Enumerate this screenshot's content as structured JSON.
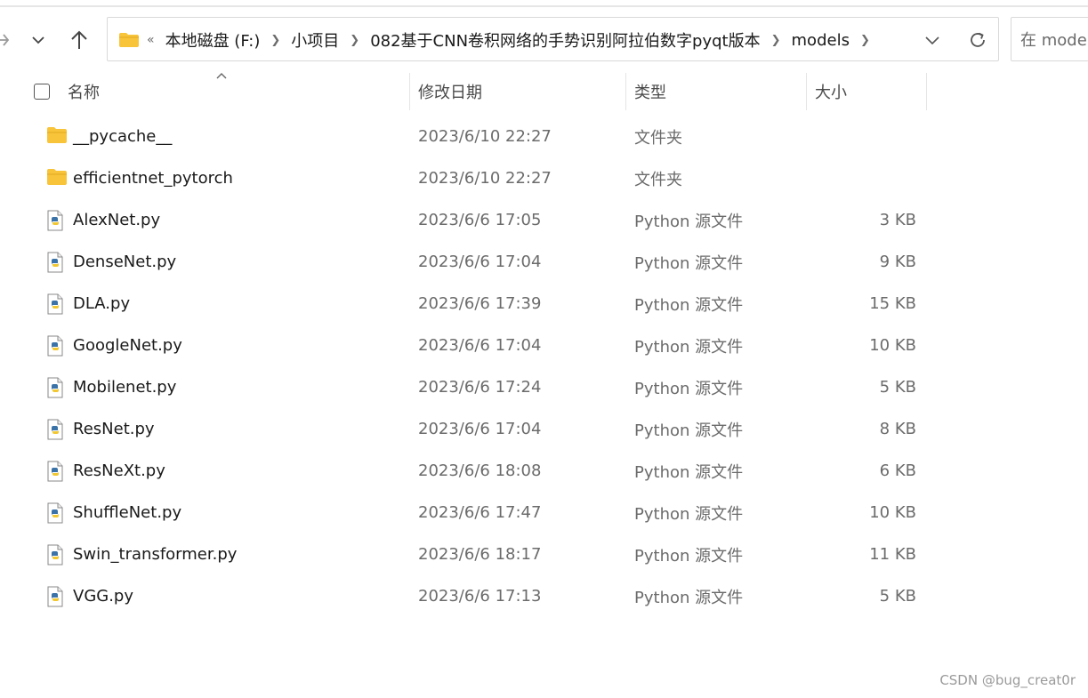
{
  "address": {
    "overflow": "«",
    "crumbs": [
      "本地磁盘 (F:)",
      "小项目",
      "082基于CNN卷积网络的手势识别阿拉伯数字pyqt版本",
      "models"
    ]
  },
  "search": {
    "placeholder": "在 models"
  },
  "columns": {
    "name": "名称",
    "date": "修改日期",
    "type": "类型",
    "size": "大小"
  },
  "files": [
    {
      "name": "__pycache__",
      "date": "2023/6/10 22:27",
      "type": "文件夹",
      "size": "",
      "icon": "folder-icon"
    },
    {
      "name": "efficientnet_pytorch",
      "date": "2023/6/10 22:27",
      "type": "文件夹",
      "size": "",
      "icon": "folder-icon"
    },
    {
      "name": "AlexNet.py",
      "date": "2023/6/6 17:05",
      "type": "Python 源文件",
      "size": "3 KB",
      "icon": "python-file-icon"
    },
    {
      "name": "DenseNet.py",
      "date": "2023/6/6 17:04",
      "type": "Python 源文件",
      "size": "9 KB",
      "icon": "python-file-icon"
    },
    {
      "name": "DLA.py",
      "date": "2023/6/6 17:39",
      "type": "Python 源文件",
      "size": "15 KB",
      "icon": "python-file-icon"
    },
    {
      "name": "GoogleNet.py",
      "date": "2023/6/6 17:04",
      "type": "Python 源文件",
      "size": "10 KB",
      "icon": "python-file-icon"
    },
    {
      "name": "Mobilenet.py",
      "date": "2023/6/6 17:24",
      "type": "Python 源文件",
      "size": "5 KB",
      "icon": "python-file-icon"
    },
    {
      "name": "ResNet.py",
      "date": "2023/6/6 17:04",
      "type": "Python 源文件",
      "size": "8 KB",
      "icon": "python-file-icon"
    },
    {
      "name": "ResNeXt.py",
      "date": "2023/6/6 18:08",
      "type": "Python 源文件",
      "size": "6 KB",
      "icon": "python-file-icon"
    },
    {
      "name": "ShuffleNet.py",
      "date": "2023/6/6 17:47",
      "type": "Python 源文件",
      "size": "10 KB",
      "icon": "python-file-icon"
    },
    {
      "name": "Swin_transformer.py",
      "date": "2023/6/6 18:17",
      "type": "Python 源文件",
      "size": "11 KB",
      "icon": "python-file-icon"
    },
    {
      "name": "VGG.py",
      "date": "2023/6/6 17:13",
      "type": "Python 源文件",
      "size": "5 KB",
      "icon": "python-file-icon"
    }
  ],
  "watermark": "CSDN @bug_creat0r",
  "colors": {
    "folder": "#f8c43a",
    "python_blue": "#3b73a8",
    "python_yellow": "#f2c832"
  }
}
